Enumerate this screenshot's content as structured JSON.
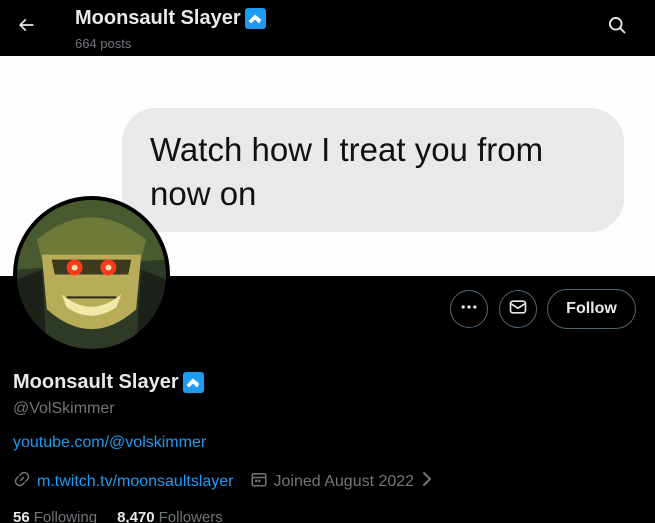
{
  "header": {
    "title": "Moonsault Slayer",
    "posts": "664 posts",
    "back_icon": "arrow-left-icon",
    "search_icon": "search-icon"
  },
  "banner": {
    "message_text": "Watch how I treat you from now on"
  },
  "actions": {
    "more_icon": "more-icon",
    "message_icon": "mail-icon",
    "follow_label": "Follow"
  },
  "profile": {
    "name": "Moonsault Slayer",
    "handle": "@VolSkimmer",
    "bio_link": "youtube.com/@volskimmer",
    "website": "m.twitch.tv/moonsaultslayer",
    "joined": "Joined August 2022",
    "following_count": "56",
    "following_label": "Following",
    "followers_count": "8,470",
    "followers_label": "Followers"
  },
  "colors": {
    "accent": "#1d9bf0",
    "background": "#000000",
    "muted": "#71767b",
    "text": "#e7e9ea"
  }
}
